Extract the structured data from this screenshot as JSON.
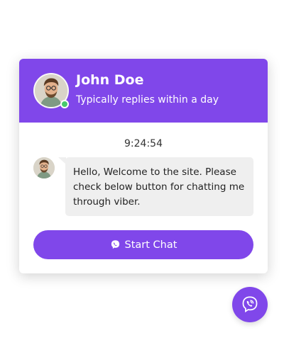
{
  "colors": {
    "accent": "#8047ea",
    "online": "#47c96d",
    "bubble": "#efefef"
  },
  "agent": {
    "name": "John Doe",
    "status": "Typically replies within a day",
    "avatar_icon": "user-avatar",
    "online_indicator": "online-status-dot"
  },
  "chat": {
    "time": "9:24:54",
    "message": "Hello, Welcome to the site. Please check below button for chatting me through viber."
  },
  "start_button": {
    "label": "Start Chat",
    "icon": "viber-icon"
  },
  "launcher": {
    "icon": "viber-icon"
  }
}
